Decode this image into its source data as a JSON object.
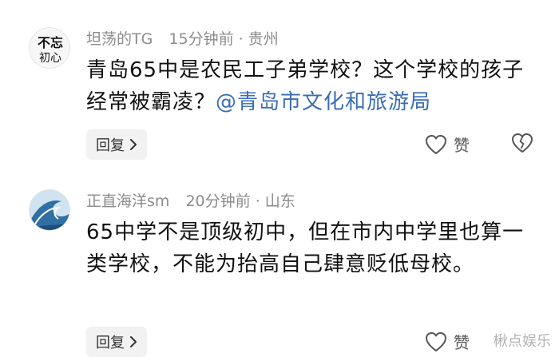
{
  "comments": [
    {
      "author": "坦荡的TG",
      "time": "15分钟前",
      "location": "· 贵州",
      "text": "青岛65中是农民工子弟学校？这个学校的孩子经常被霸凌？",
      "mention": "@青岛市文化和旅游局",
      "reply_label": "回复",
      "like_label": "赞",
      "avatar_text": "不忘初心"
    },
    {
      "author": "正直海洋sm",
      "time": "20分钟前",
      "location": "· 山东",
      "text": "65中学不是顶级初中，但在市内中学里也算一类学校，不能为抬高自己肆意贬低母校。",
      "reply_label": "回复",
      "like_label": "赞"
    }
  ],
  "watermark": "楸点娱乐",
  "icons": {
    "like": "heart-outline-icon",
    "dislike": "broken-heart-icon",
    "reply_arrow": "chevron-right-icon"
  }
}
